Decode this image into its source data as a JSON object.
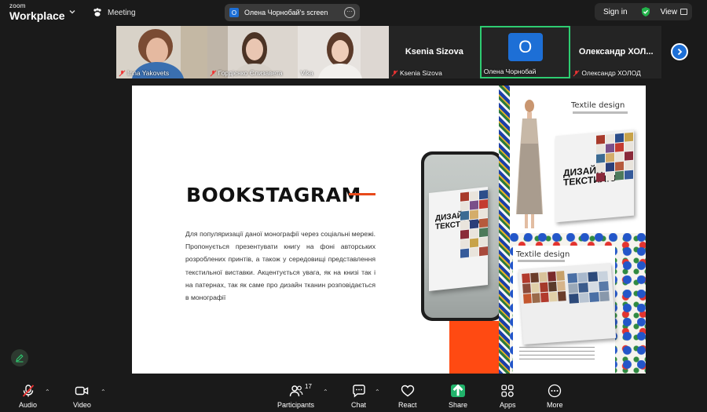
{
  "app": {
    "brand_small": "zoom",
    "brand_big": "Workplace",
    "meeting_label": "Meeting"
  },
  "screen_share": {
    "avatar_letter": "О",
    "label": "Олена Чорнобай's screen"
  },
  "top_right": {
    "sign_in": "Sign in",
    "view": "View"
  },
  "participants": [
    {
      "name": "Inna Yakovets",
      "muted": true,
      "type": "video"
    },
    {
      "name": "Гордієнко Єлизавета",
      "muted": true,
      "type": "video"
    },
    {
      "name": "Vika",
      "muted": false,
      "type": "video"
    },
    {
      "name": "Ksenia Sizova",
      "muted": true,
      "type": "name",
      "big_name": "Ksenia Sizova"
    },
    {
      "name": "Олена Чорнобай",
      "muted": false,
      "type": "avatar",
      "avatar_letter": "О",
      "active": true
    },
    {
      "name": "Олександр ХОЛОД",
      "muted": true,
      "type": "name",
      "big_name": "Олександр  ХОЛ..."
    }
  ],
  "slide": {
    "title": "BOOKSTAGRAM",
    "body": "Для популяризації даної монографії через соціальні мережі. Пропонується презентувати книгу на фоні авторських розроблених принтів, а також у середовищі представлення текстильної виставки. Акцентується увага, як на книзі так і на патернах, так як саме про дизайн тканин розповідається в монографії",
    "book_title": "ДИЗАЙН ТЕКСТИЛЮ",
    "top_panel_title": "Textile design",
    "bottom_panel_title": "Textile design",
    "accent_color": "#ff4a12"
  },
  "toolbar": {
    "audio": "Audio",
    "video": "Video",
    "participants": "Participants",
    "participants_count": "17",
    "chat": "Chat",
    "react": "React",
    "share": "Share",
    "apps": "Apps",
    "more": "More"
  }
}
